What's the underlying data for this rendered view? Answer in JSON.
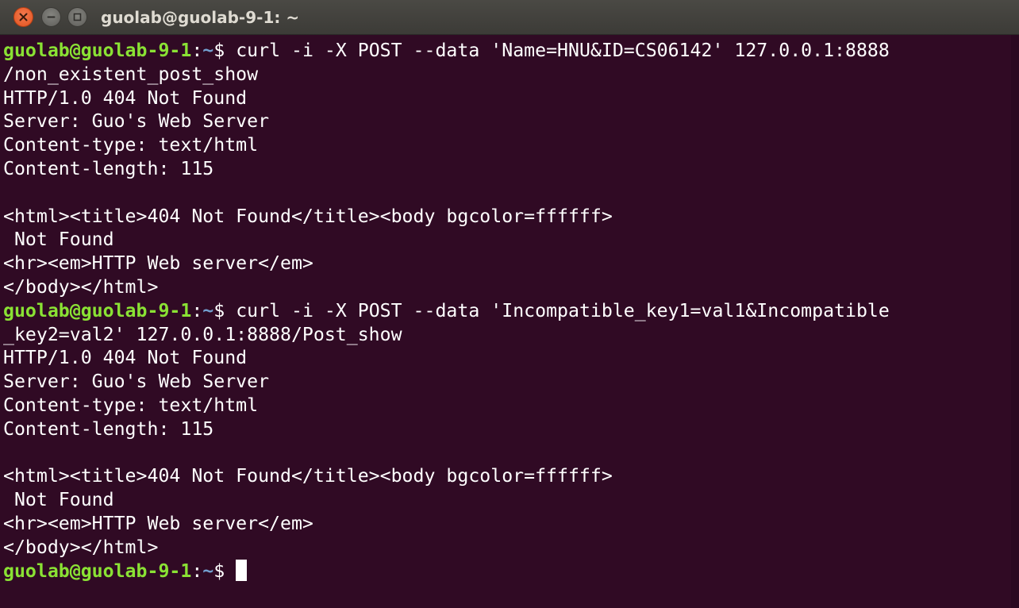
{
  "window": {
    "title": "guolab@guolab-9-1: ~",
    "buttons": {
      "close_icon": "close-icon",
      "minimize_icon": "minimize-icon",
      "maximize_icon": "maximize-icon"
    }
  },
  "colors": {
    "background": "#300a24",
    "prompt_user": "#8ae234",
    "prompt_path": "#729fcf",
    "text": "#ffffff",
    "close_button": "#e2531e"
  },
  "terminal": {
    "prompt": {
      "user_host": "guolab@guolab-9-1",
      "colon": ":",
      "path": "~",
      "symbol": "$ "
    },
    "lines": [
      {
        "type": "prompt",
        "text": "curl -i -X POST --data 'Name=HNU&ID=CS06142' 127.0.0.1:8888"
      },
      {
        "type": "output",
        "text": "/non_existent_post_show"
      },
      {
        "type": "output",
        "text": "HTTP/1.0 404 Not Found"
      },
      {
        "type": "output",
        "text": "Server: Guo's Web Server"
      },
      {
        "type": "output",
        "text": "Content-type: text/html"
      },
      {
        "type": "output",
        "text": "Content-length: 115"
      },
      {
        "type": "output",
        "text": ""
      },
      {
        "type": "output",
        "text": "<html><title>404 Not Found</title><body bgcolor=ffffff>"
      },
      {
        "type": "output",
        "text": " Not Found"
      },
      {
        "type": "output",
        "text": "<hr><em>HTTP Web server</em>"
      },
      {
        "type": "output",
        "text": "</body></html>"
      },
      {
        "type": "prompt",
        "text": "curl -i -X POST --data 'Incompatible_key1=val1&Incompatible"
      },
      {
        "type": "output",
        "text": "_key2=val2' 127.0.0.1:8888/Post_show"
      },
      {
        "type": "output",
        "text": "HTTP/1.0 404 Not Found"
      },
      {
        "type": "output",
        "text": "Server: Guo's Web Server"
      },
      {
        "type": "output",
        "text": "Content-type: text/html"
      },
      {
        "type": "output",
        "text": "Content-length: 115"
      },
      {
        "type": "output",
        "text": ""
      },
      {
        "type": "output",
        "text": "<html><title>404 Not Found</title><body bgcolor=ffffff>"
      },
      {
        "type": "output",
        "text": " Not Found"
      },
      {
        "type": "output",
        "text": "<hr><em>HTTP Web server</em>"
      },
      {
        "type": "output",
        "text": "</body></html>"
      },
      {
        "type": "prompt",
        "text": "",
        "cursor": true
      }
    ]
  }
}
